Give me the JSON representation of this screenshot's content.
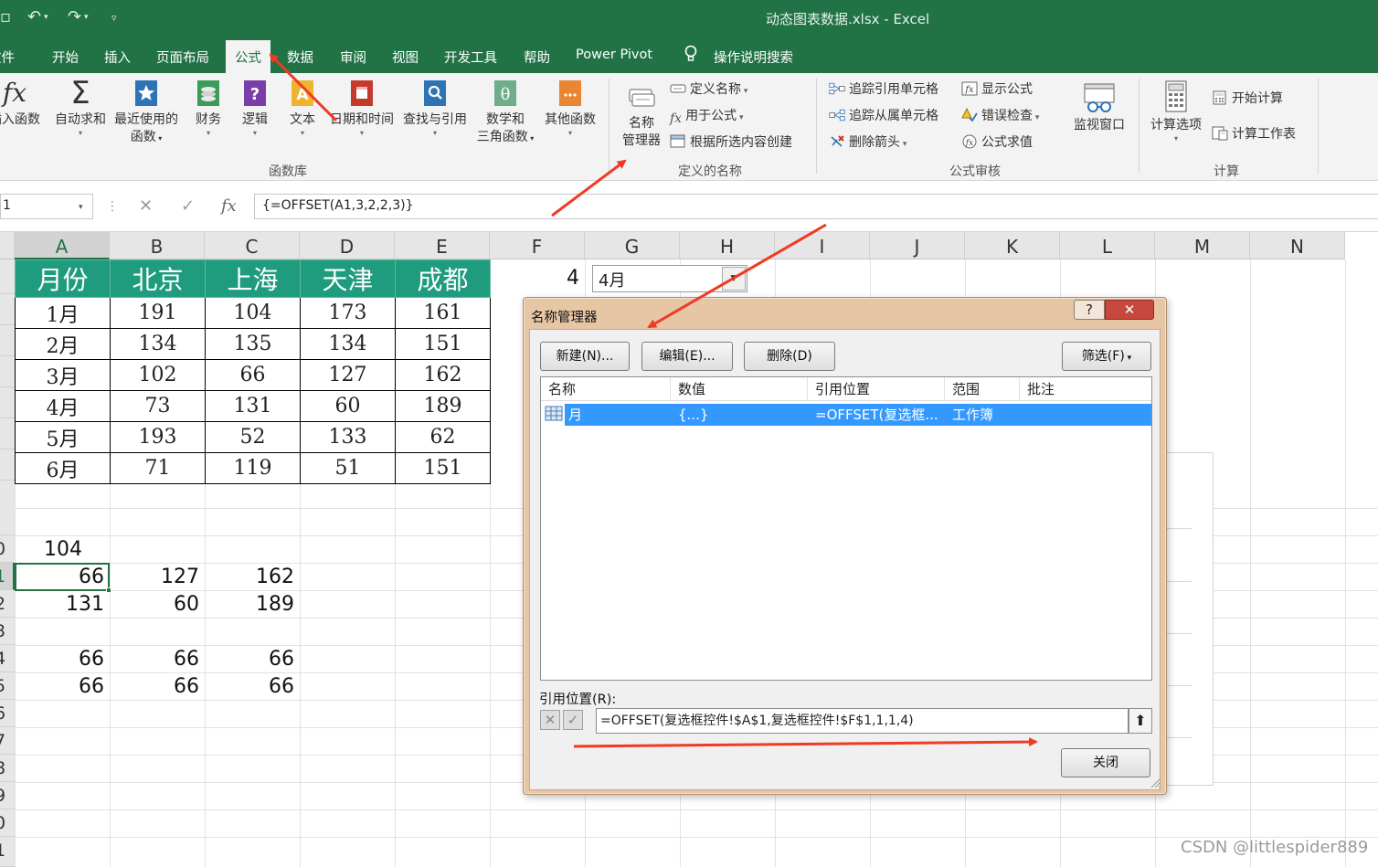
{
  "window": {
    "title": "动态图表数据.xlsx  -  Excel"
  },
  "ribbon_tabs": [
    "文件",
    "开始",
    "插入",
    "页面布局",
    "公式",
    "数据",
    "审阅",
    "视图",
    "开发工具",
    "帮助",
    "Power Pivot"
  ],
  "active_tab": "公式",
  "tell_me": "操作说明搜索",
  "function_library": {
    "insert_function": "插入函数",
    "autosum": "自动求和",
    "recent": "最近使用的",
    "recent_line2": "函数",
    "financial": "财务",
    "logical": "逻辑",
    "text": "文本",
    "datetime": "日期和时间",
    "lookup": "查找与引用",
    "math": "数学和",
    "math_line2": "三角函数",
    "more": "其他函数",
    "group_label": "函数库"
  },
  "defined_names": {
    "name_manager": "名称",
    "name_manager_line2": "管理器",
    "define_name": "定义名称",
    "use_in_formula": "用于公式",
    "create_from_selection": "根据所选内容创建",
    "group_label": "定义的名称"
  },
  "formula_auditing": {
    "trace_precedents": "追踪引用单元格",
    "trace_dependents": "追踪从属单元格",
    "remove_arrows": "删除箭头",
    "show_formulas": "显示公式",
    "error_checking": "错误检查",
    "evaluate_formula": "公式求值",
    "watch_window": "监视窗口",
    "group_label": "公式审核"
  },
  "calculation": {
    "options": "计算选项",
    "calc_now": "开始计算",
    "calc_sheet": "计算工作表",
    "group_label": "计算"
  },
  "formula_bar": {
    "name_box": "1",
    "formula": "{=OFFSET(A1,3,2,2,3)}",
    "fx": "fx"
  },
  "columns": [
    "A",
    "B",
    "C",
    "D",
    "E",
    "F",
    "G",
    "H",
    "I",
    "J",
    "K",
    "L",
    "M",
    "N"
  ],
  "selected_column": "A",
  "row_numbers": [
    "",
    "",
    "",
    "",
    "",
    "",
    "",
    "",
    "0",
    "1",
    "2",
    "3",
    "4",
    "5",
    "6",
    "7",
    "8",
    "9",
    "0",
    "1"
  ],
  "table": {
    "headers": [
      "月份",
      "北京",
      "上海",
      "天津",
      "成都"
    ],
    "rows": [
      [
        "1月",
        "191",
        "104",
        "173",
        "161"
      ],
      [
        "2月",
        "134",
        "135",
        "134",
        "151"
      ],
      [
        "3月",
        "102",
        "66",
        "127",
        "162"
      ],
      [
        "4月",
        "73",
        "131",
        "60",
        "189"
      ],
      [
        "5月",
        "193",
        "52",
        "133",
        "62"
      ],
      [
        "6月",
        "71",
        "119",
        "51",
        "151"
      ]
    ]
  },
  "cells": {
    "r10": [
      "104"
    ],
    "r11": [
      "66",
      "127",
      "162"
    ],
    "r12": [
      "131",
      "60",
      "189"
    ],
    "r14": [
      "66",
      "66",
      "66"
    ],
    "r15": [
      "66",
      "66",
      "66"
    ],
    "f1": "4",
    "combo_value": "4月"
  },
  "dialog": {
    "title": "名称管理器",
    "help": "?",
    "new_btn": "新建(N)...",
    "edit_btn": "编辑(E)...",
    "delete_btn": "删除(D)",
    "filter_btn": "筛选(F)",
    "columns": [
      "名称",
      "数值",
      "引用位置",
      "范围",
      "批注"
    ],
    "entries": [
      {
        "name": "月",
        "value": "{...}",
        "refers_to": "=OFFSET(复选框...",
        "scope": "工作簿",
        "comment": ""
      }
    ],
    "refers_to_label": "引用位置(R):",
    "refers_to_value": "=OFFSET(复选框控件!$A$1,复选框控件!$F$1,1,1,4)",
    "close_btn": "关闭"
  },
  "watermark": "CSDN @littlespider889",
  "colors": {
    "excel_green": "#217346",
    "header_fill": "#1e9c7d",
    "selection_blue": "#3399ff",
    "arrow_red": "#f03a24"
  }
}
